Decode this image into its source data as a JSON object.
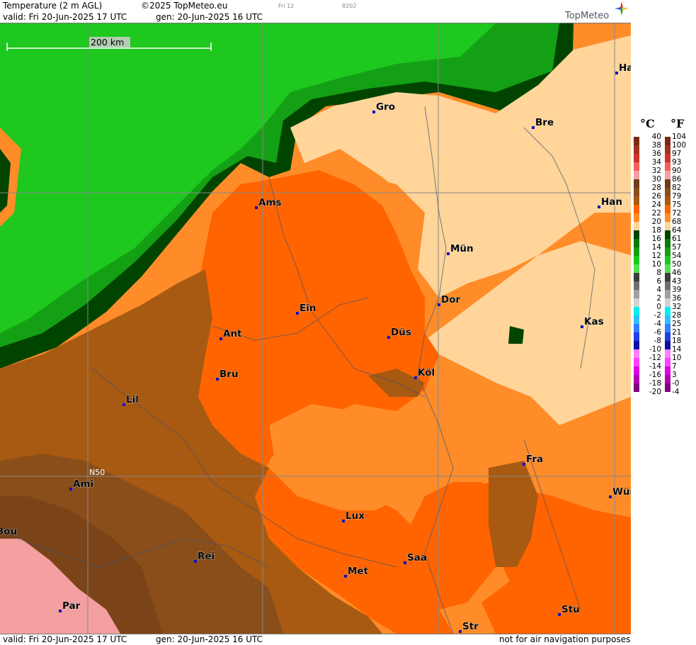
{
  "header": {
    "title": "Temperature (2 m AGL)",
    "copyright": "©2025 TopMeteo.eu",
    "run_code": "Fri 12",
    "id_code": "8202",
    "valid": "valid:  Fri  20-Jun-2025  17 UTC",
    "gen": "gen: 20-Jun-2025 16 UTC",
    "brand": "TopMeteo"
  },
  "footer": {
    "valid": "valid:  Fri  20-Jun-2025  17 UTC",
    "gen": "gen: 20-Jun-2025 16 UTC",
    "notice": "not for air navigation purposes"
  },
  "map": {
    "scale_label": "200 km",
    "lat_label": "N50",
    "cities": [
      "Gro",
      "Bre",
      "Ham",
      "Ams",
      "Han",
      "Mün",
      "Dor",
      "Ein",
      "Kas",
      "Düs",
      "Ant",
      "Köl",
      "Bru",
      "Lil",
      "Fra",
      "Ami",
      "Wür",
      "Lux",
      "Rei",
      "Saa",
      "Met",
      "Par",
      "Stu",
      "Str",
      "Bou"
    ]
  },
  "legend": {
    "unit_c": "°C",
    "unit_f": "°F",
    "celsius": [
      "40",
      "38",
      "36",
      "34",
      "32",
      "30",
      "28",
      "26",
      "24",
      "22",
      "20",
      "18",
      "16",
      "14",
      "12",
      "10",
      "8",
      "6",
      "4",
      "2",
      "0",
      "-2",
      "-4",
      "-6",
      "-8",
      "-10",
      "-12",
      "-14",
      "-16",
      "-18",
      "-20"
    ],
    "fahrenheit": [
      "104",
      "100",
      "97",
      "93",
      "90",
      "86",
      "82",
      "79",
      "75",
      "72",
      "68",
      "64",
      "61",
      "57",
      "54",
      "50",
      "46",
      "43",
      "39",
      "36",
      "32",
      "28",
      "25",
      "21",
      "18",
      "14",
      "10",
      "7",
      "3",
      "-0",
      "-4"
    ],
    "colors": [
      "#7a2a10",
      "#a0321e",
      "#d0322a",
      "#f0605c",
      "#f4a0a0",
      "#6e3c18",
      "#8a4e1a",
      "#a85a12",
      "#ff6400",
      "#ff8c28",
      "#ffd59a",
      "#004400",
      "#0a7a0a",
      "#14a014",
      "#1ec81e",
      "#50e050",
      "#3c3c3c",
      "#6e6e6e",
      "#a0a0a0",
      "#d2d2d2",
      "#00f0f0",
      "#30c0ff",
      "#3080ff",
      "#2040e0",
      "#1010a0",
      "#ff80ff",
      "#ff40ff",
      "#e000e0",
      "#b000b0",
      "#800080"
    ]
  }
}
